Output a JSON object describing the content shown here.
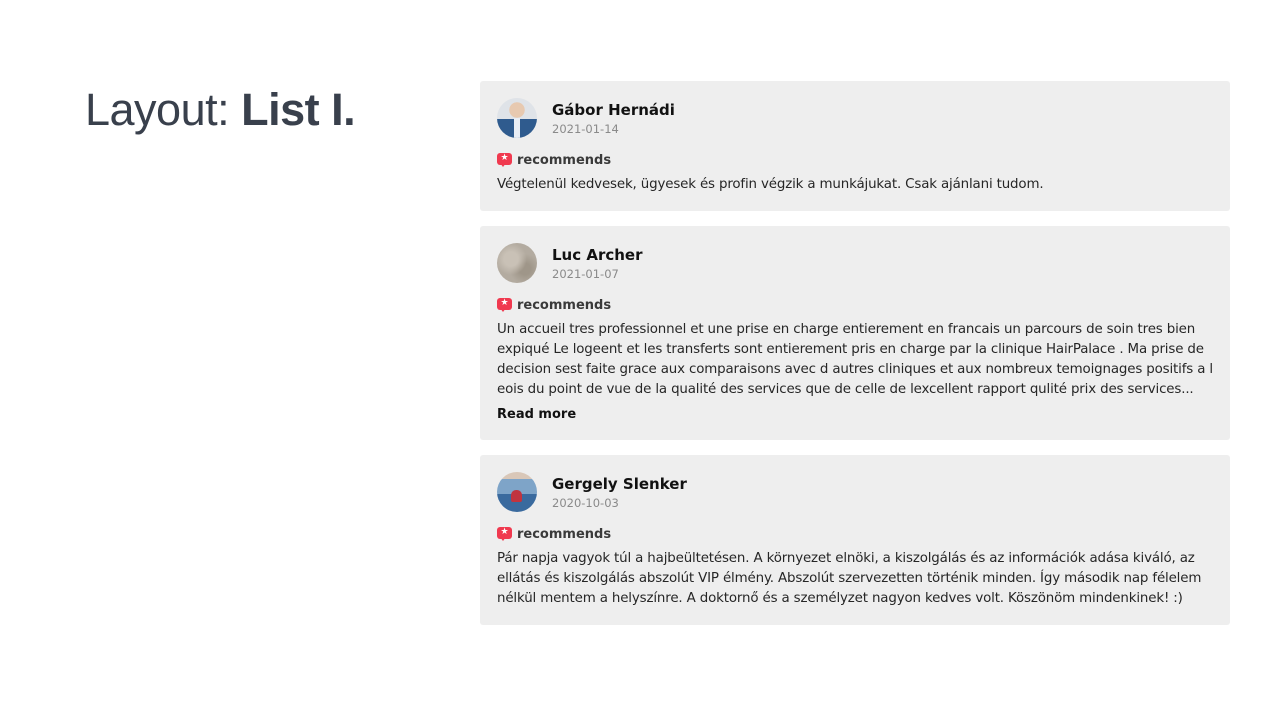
{
  "title": {
    "prefix": "Layout: ",
    "emphasis": "List I."
  },
  "reviews": [
    {
      "name": "Gábor Hernádi",
      "date": "2021-01-14",
      "badge": "recommends",
      "text": "Végtelenül kedvesek, ügyesek és profin végzik a munkájukat. Csak ajánlani tudom."
    },
    {
      "name": "Luc Archer",
      "date": "2021-01-07",
      "badge": "recommends",
      "text": "Un accueil tres professionnel et une prise en charge entierement en francais un parcours de soin tres bien expiqué Le logeent et les transferts sont entierement pris en charge par la clinique HairPalace . Ma prise de decision sest faite grace aux comparaisons avec d autres cliniques et aux nombreux temoignages positifs a l eois du point de vue de la qualité des services que de celle de lexcellent rapport qulité prix des services...",
      "read_more": "Read more"
    },
    {
      "name": "Gergely Slenker",
      "date": "2020-10-03",
      "badge": "recommends",
      "text": "Pár napja vagyok túl a hajbeültetésen. A környezet elnöki, a kiszolgálás és az információk adása kiváló, az ellátás és kiszolgálás abszolút VIP élmény. Abszolút szervezetten történik minden. Így második nap félelem nélkül mentem a helyszínre. A doktornő és a személyzet nagyon kedves volt. Köszönöm mindenkinek! :)"
    }
  ],
  "colors": {
    "title": "#39404c",
    "card_background": "#eeeeee",
    "badge_accent": "#f0394f",
    "date": "#8a8a8a"
  },
  "icons": {
    "badge": "recommend-star-bubble-icon"
  }
}
